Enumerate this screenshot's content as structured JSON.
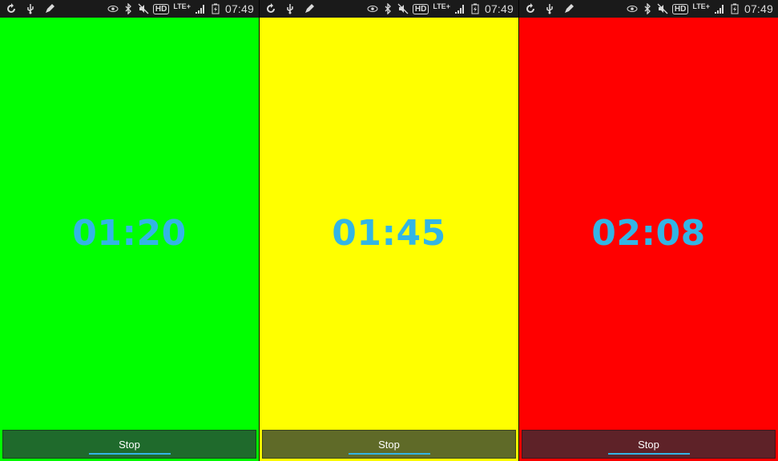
{
  "status_bar": {
    "hd_label": "HD",
    "network_label": "LTE+",
    "time": "07:49",
    "icons": [
      "sync-icon",
      "usb-icon",
      "pen-icon",
      "eye-icon",
      "bluetooth-icon",
      "mute-icon",
      "hd-icon",
      "lte-icon",
      "signal-icon",
      "battery-icon"
    ]
  },
  "screens": [
    {
      "timer": "01:20",
      "stop_label": "Stop",
      "background": "#00ff00",
      "button_color": "#1f6a2c"
    },
    {
      "timer": "01:45",
      "stop_label": "Stop",
      "background": "#ffff00",
      "button_color": "#5f6a28"
    },
    {
      "timer": "02:08",
      "stop_label": "Stop",
      "background": "#ff0000",
      "button_color": "#5e2228"
    }
  ],
  "accent_color": "#33b5e5"
}
